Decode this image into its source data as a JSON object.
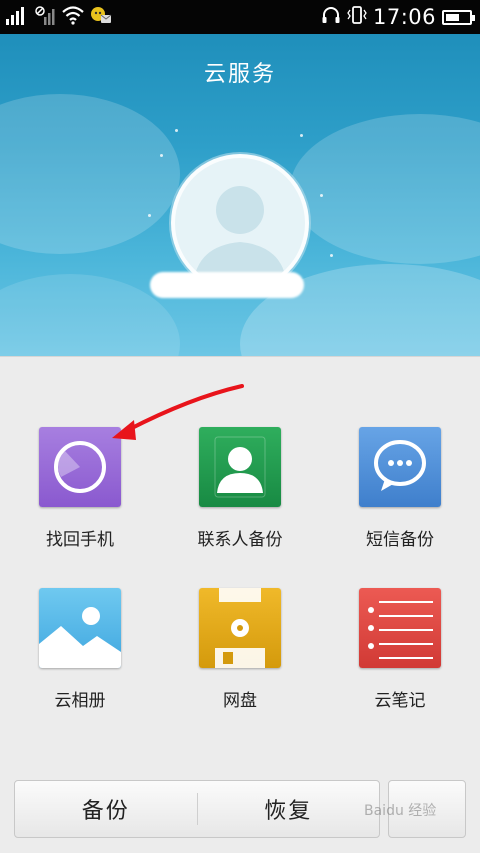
{
  "status_bar": {
    "time": "17:06",
    "battery_level": 0.6,
    "icons": [
      "signal-icon",
      "no-data-icon",
      "wifi-icon",
      "notification-icon",
      "headphones-icon",
      "vibrate-icon",
      "battery-icon"
    ]
  },
  "header": {
    "title": "云服务",
    "username": ""
  },
  "tiles": [
    {
      "label": "找回手机",
      "icon": "find-phone-icon",
      "color": "#9b6bd6"
    },
    {
      "label": "联系人备份",
      "icon": "contacts-icon",
      "color": "#1f9a4f"
    },
    {
      "label": "短信备份",
      "icon": "message-icon",
      "color": "#4d8fd8"
    },
    {
      "label": "云相册",
      "icon": "photo-icon",
      "color": "#5ab7e8"
    },
    {
      "label": "网盘",
      "icon": "disk-icon",
      "color": "#e2a814"
    },
    {
      "label": "云笔记",
      "icon": "notes-icon",
      "color": "#e04743"
    }
  ],
  "bottom": {
    "backup_label": "备份",
    "restore_label": "恢复"
  },
  "watermark": "Baidu 经验",
  "colors": {
    "header_top": "#1f8fbb",
    "header_bottom": "#6cc6e5",
    "annotation_arrow": "#e8141b"
  }
}
